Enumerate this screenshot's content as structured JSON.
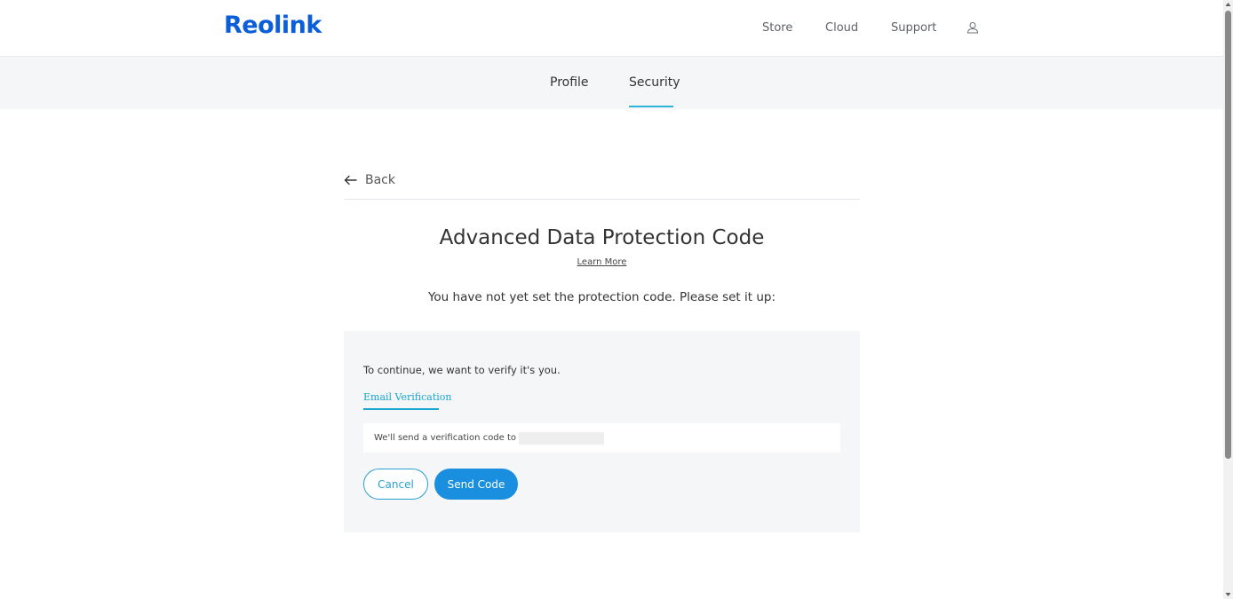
{
  "header": {
    "logo": "Reolink",
    "nav": [
      {
        "label": "Store"
      },
      {
        "label": "Cloud"
      },
      {
        "label": "Support"
      }
    ],
    "user_icon": "user-icon"
  },
  "tabs": [
    {
      "label": "Profile",
      "active": false
    },
    {
      "label": "Security",
      "active": true
    }
  ],
  "main": {
    "back_label": "Back",
    "title": "Advanced Data Protection Code",
    "learn_more": "Learn More",
    "subtitle": "You have not yet set the protection code. Please set it up:"
  },
  "card": {
    "lead": "To continue, we want to verify it's you.",
    "tab_label": "Email Verification",
    "email_text": "We'll send a verification code to",
    "cancel_label": "Cancel",
    "send_label": "Send Code"
  },
  "colors": {
    "brand": "#0b5ed7",
    "accent": "#2cb5d8",
    "primary_button": "#1a8fe0"
  }
}
